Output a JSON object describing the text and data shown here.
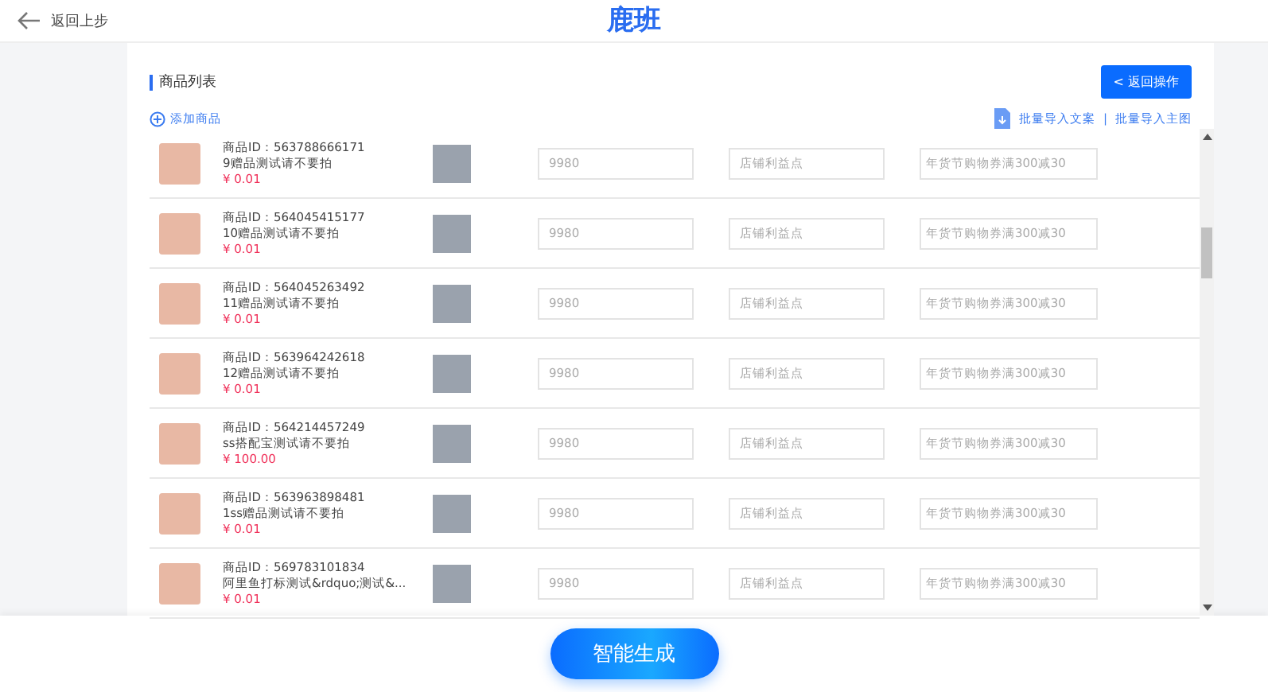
{
  "header": {
    "back_label": "返回上步",
    "logo": "鹿班"
  },
  "panel": {
    "title": "商品列表",
    "return_button": "< 返回操作",
    "add_label": "添加商品",
    "import_copy": "批量导入文案",
    "separator": "|",
    "import_image": "批量导入主图"
  },
  "products": [
    {
      "id": "商品ID：563788666171",
      "name": "9赠品测试请不要拍",
      "price": "¥ 0.01",
      "price_field": {
        "placeholder": "9980"
      },
      "benefit_field": {
        "placeholder": "店铺利益点"
      },
      "promo_field": {
        "placeholder": "年货节购物券满300减30"
      }
    },
    {
      "id": "商品ID：564045415177",
      "name": "10赠品测试请不要拍",
      "price": "¥ 0.01",
      "price_field": {
        "placeholder": "9980"
      },
      "benefit_field": {
        "placeholder": "店铺利益点"
      },
      "promo_field": {
        "placeholder": "年货节购物券满300减30"
      }
    },
    {
      "id": "商品ID：564045263492",
      "name": "11赠品测试请不要拍",
      "price": "¥ 0.01",
      "price_field": {
        "placeholder": "9980"
      },
      "benefit_field": {
        "placeholder": "店铺利益点"
      },
      "promo_field": {
        "placeholder": "年货节购物券满300减30"
      }
    },
    {
      "id": "商品ID：563964242618",
      "name": "12赠品测试请不要拍",
      "price": "¥ 0.01",
      "price_field": {
        "placeholder": "9980"
      },
      "benefit_field": {
        "placeholder": "店铺利益点"
      },
      "promo_field": {
        "placeholder": "年货节购物券满300减30"
      }
    },
    {
      "id": "商品ID：564214457249",
      "name": "ss搭配宝测试请不要拍",
      "price": "¥ 100.00",
      "price_field": {
        "placeholder": "9980"
      },
      "benefit_field": {
        "placeholder": "店铺利益点"
      },
      "promo_field": {
        "placeholder": "年货节购物券满300减30"
      }
    },
    {
      "id": "商品ID：563963898481",
      "name": "1ss赠品测试请不要拍",
      "price": "¥ 0.01",
      "price_field": {
        "placeholder": "9980"
      },
      "benefit_field": {
        "placeholder": "店铺利益点"
      },
      "promo_field": {
        "placeholder": "年货节购物券满300减30"
      }
    },
    {
      "id": "商品ID：569783101834",
      "name": "阿里鱼打标测试&rdquo;测试&...",
      "price": "¥ 0.01",
      "price_field": {
        "placeholder": "9980"
      },
      "benefit_field": {
        "placeholder": "店铺利益点"
      },
      "promo_field": {
        "placeholder": "年货节购物券满300减30"
      }
    }
  ],
  "footer": {
    "generate_button": "智能生成"
  }
}
